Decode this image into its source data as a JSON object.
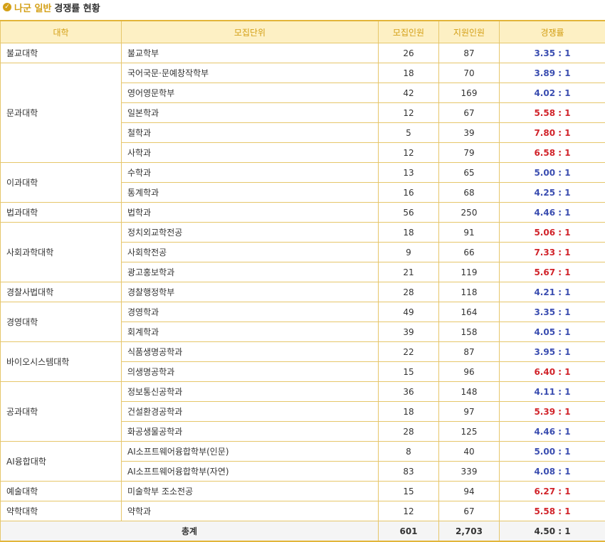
{
  "title": {
    "highlight": "나군 일반",
    "rest": "경쟁률 현황"
  },
  "headers": [
    "대학",
    "모집단위",
    "모집인원",
    "지원인원",
    "경쟁률"
  ],
  "groups": [
    {
      "college": "불교대학",
      "rows": [
        {
          "unit": "불교학부",
          "quota": "26",
          "applicants": "87",
          "rate": "3.35 : 1",
          "color": "blue"
        }
      ]
    },
    {
      "college": "문과대학",
      "rows": [
        {
          "unit": "국어국문·문예창작학부",
          "quota": "18",
          "applicants": "70",
          "rate": "3.89 : 1",
          "color": "blue"
        },
        {
          "unit": "영어영문학부",
          "quota": "42",
          "applicants": "169",
          "rate": "4.02 : 1",
          "color": "blue"
        },
        {
          "unit": "일본학과",
          "quota": "12",
          "applicants": "67",
          "rate": "5.58 : 1",
          "color": "red"
        },
        {
          "unit": "철학과",
          "quota": "5",
          "applicants": "39",
          "rate": "7.80 : 1",
          "color": "red"
        },
        {
          "unit": "사학과",
          "quota": "12",
          "applicants": "79",
          "rate": "6.58 : 1",
          "color": "red"
        }
      ]
    },
    {
      "college": "이과대학",
      "rows": [
        {
          "unit": "수학과",
          "quota": "13",
          "applicants": "65",
          "rate": "5.00 : 1",
          "color": "blue"
        },
        {
          "unit": "통계학과",
          "quota": "16",
          "applicants": "68",
          "rate": "4.25 : 1",
          "color": "blue"
        }
      ]
    },
    {
      "college": "법과대학",
      "rows": [
        {
          "unit": "법학과",
          "quota": "56",
          "applicants": "250",
          "rate": "4.46 : 1",
          "color": "blue"
        }
      ]
    },
    {
      "college": "사회과학대학",
      "rows": [
        {
          "unit": "정치외교학전공",
          "quota": "18",
          "applicants": "91",
          "rate": "5.06 : 1",
          "color": "red"
        },
        {
          "unit": "사회학전공",
          "quota": "9",
          "applicants": "66",
          "rate": "7.33 : 1",
          "color": "red"
        },
        {
          "unit": "광고홍보학과",
          "quota": "21",
          "applicants": "119",
          "rate": "5.67 : 1",
          "color": "red"
        }
      ]
    },
    {
      "college": "경찰사법대학",
      "rows": [
        {
          "unit": "경찰행정학부",
          "quota": "28",
          "applicants": "118",
          "rate": "4.21 : 1",
          "color": "blue"
        }
      ]
    },
    {
      "college": "경영대학",
      "rows": [
        {
          "unit": "경영학과",
          "quota": "49",
          "applicants": "164",
          "rate": "3.35 : 1",
          "color": "blue"
        },
        {
          "unit": "회계학과",
          "quota": "39",
          "applicants": "158",
          "rate": "4.05 : 1",
          "color": "blue"
        }
      ]
    },
    {
      "college": "바이오시스템대학",
      "rows": [
        {
          "unit": "식품생명공학과",
          "quota": "22",
          "applicants": "87",
          "rate": "3.95 : 1",
          "color": "blue"
        },
        {
          "unit": "의생명공학과",
          "quota": "15",
          "applicants": "96",
          "rate": "6.40 : 1",
          "color": "red"
        }
      ]
    },
    {
      "college": "공과대학",
      "rows": [
        {
          "unit": "정보통신공학과",
          "quota": "36",
          "applicants": "148",
          "rate": "4.11 : 1",
          "color": "blue"
        },
        {
          "unit": "건설환경공학과",
          "quota": "18",
          "applicants": "97",
          "rate": "5.39 : 1",
          "color": "red"
        },
        {
          "unit": "화공생물공학과",
          "quota": "28",
          "applicants": "125",
          "rate": "4.46 : 1",
          "color": "blue"
        }
      ]
    },
    {
      "college": "AI융합대학",
      "rows": [
        {
          "unit": "AI소프트웨어융합학부(인문)",
          "quota": "8",
          "applicants": "40",
          "rate": "5.00 : 1",
          "color": "blue"
        },
        {
          "unit": "AI소프트웨어융합학부(자연)",
          "quota": "83",
          "applicants": "339",
          "rate": "4.08 : 1",
          "color": "blue"
        }
      ]
    },
    {
      "college": "예술대학",
      "rows": [
        {
          "unit": "미술학부 조소전공",
          "quota": "15",
          "applicants": "94",
          "rate": "6.27 : 1",
          "color": "red"
        }
      ]
    },
    {
      "college": "약학대학",
      "rows": [
        {
          "unit": "약학과",
          "quota": "12",
          "applicants": "67",
          "rate": "5.58 : 1",
          "color": "red"
        }
      ]
    }
  ],
  "total": {
    "label": "총계",
    "quota": "601",
    "applicants": "2,703",
    "rate": "4.50 : 1"
  }
}
